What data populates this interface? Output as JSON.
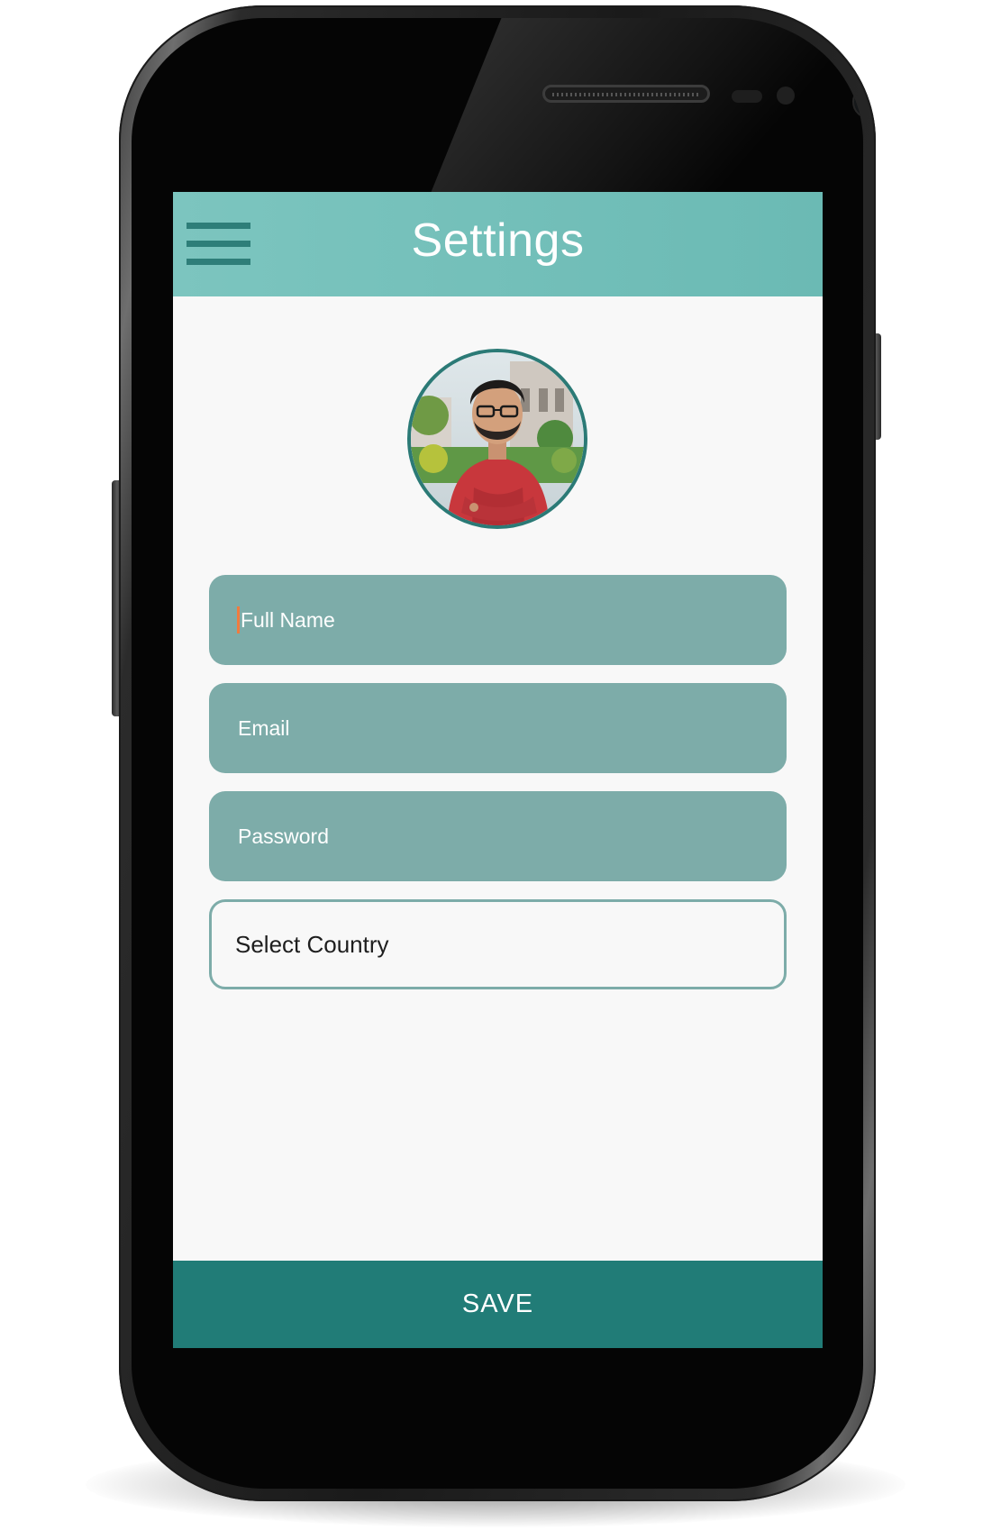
{
  "app_bar": {
    "title": "Settings",
    "menu_icon": "hamburger-menu-icon",
    "color": "#6bbab4"
  },
  "profile": {
    "avatar_alt": "profile photo",
    "border_color": "#2b7a76"
  },
  "form": {
    "full_name": {
      "placeholder": "Full Name",
      "value": ""
    },
    "email": {
      "placeholder": "Email",
      "value": ""
    },
    "password": {
      "placeholder": "Password",
      "value": ""
    },
    "country": {
      "label": "Select Country"
    },
    "field_color": "#7daca9",
    "cursor_color": "#f07b3f"
  },
  "actions": {
    "save_label": "SAVE",
    "save_color": "#217c77"
  }
}
